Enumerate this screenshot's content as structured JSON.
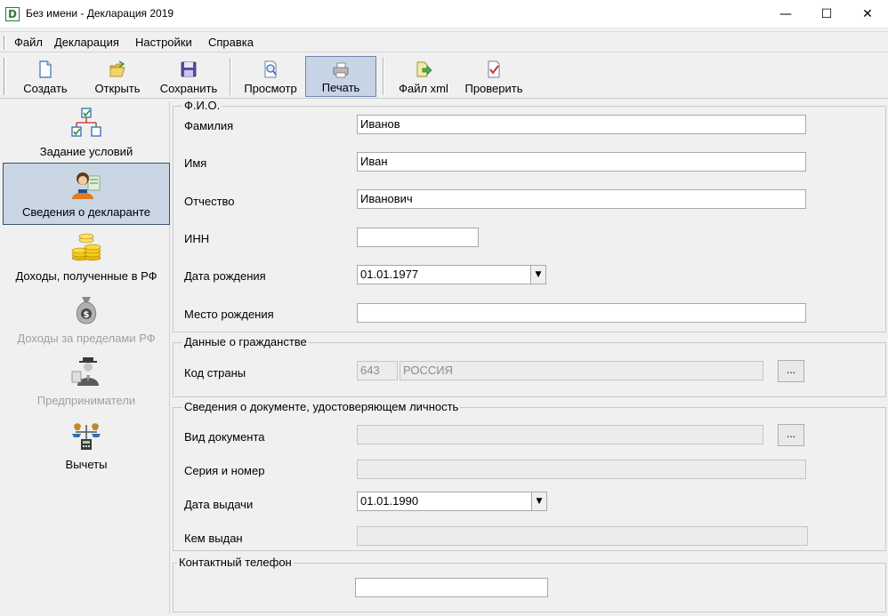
{
  "window": {
    "icon_letter": "D",
    "title": "Без имени - Декларация 2019",
    "minimize": "—",
    "maximize": "☐",
    "close": "✕"
  },
  "menu": [
    "Файл",
    "Декларация",
    "Настройки",
    "Справка"
  ],
  "toolbar": {
    "create": "Создать",
    "open": "Открыть",
    "save": "Сохранить",
    "preview": "Просмотр",
    "print": "Печать",
    "file_xml": "Файл xml",
    "check": "Проверить"
  },
  "nav": [
    {
      "label": "Задание условий"
    },
    {
      "label": "Сведения о декларанте"
    },
    {
      "label": "Доходы, полученные в РФ"
    },
    {
      "label": "Доходы за пределами РФ"
    },
    {
      "label": "Предприниматели"
    },
    {
      "label": "Вычеты"
    }
  ],
  "fio": {
    "title": "Ф.И.О.",
    "surname_label": "Фамилия",
    "surname": "Иванов",
    "name_label": "Имя",
    "name": "Иван",
    "patronymic_label": "Отчество",
    "patronymic": "Иванович",
    "inn_label": "ИНН",
    "inn": "",
    "birth_date_label": "Дата рождения",
    "birth_date": "01.01.1977",
    "birth_place_label": "Место рождения",
    "birth_place": ""
  },
  "citizenship": {
    "title": "Данные о гражданстве",
    "country_label": "Код страны",
    "country_code": "643",
    "country_name": "РОССИЯ",
    "browse": "..."
  },
  "document": {
    "title": "Сведения о документе, удостоверяющем личность",
    "doc_type_label": "Вид документа",
    "doc_type": "",
    "browse": "...",
    "series_label": "Серия и номер",
    "series": "",
    "issue_date_label": "Дата выдачи",
    "issue_date": "01.01.1990",
    "issued_by_label": "Кем выдан",
    "issued_by": ""
  },
  "contact": {
    "title": "Контактный телефон",
    "phone": ""
  },
  "colors": {
    "selected_bg": "#cad6e4",
    "toolbar_active_bg": "#c7d4e6",
    "disabled_text": "#a0a0a0",
    "app_icon_green": "#2e7d32"
  }
}
